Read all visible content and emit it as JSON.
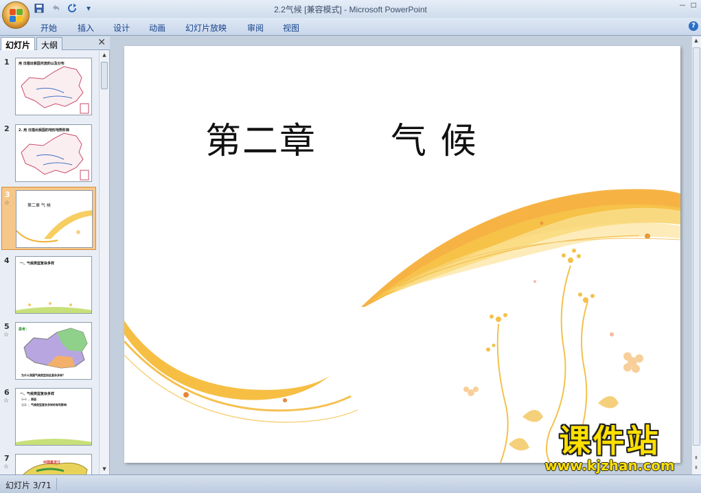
{
  "window": {
    "title": "2.2气候 [兼容模式] - Microsoft PowerPoint",
    "controls": [
      "—",
      "□"
    ]
  },
  "qat": {
    "save_icon": "save-icon",
    "undo_icon": "undo-icon",
    "redo_icon": "redo-icon",
    "customize": "▾"
  },
  "ribbon": {
    "tabs": [
      "开始",
      "插入",
      "设计",
      "动画",
      "幻灯片放映",
      "审阅",
      "视图"
    ],
    "help": "?"
  },
  "pane": {
    "tab_slides": "幻灯片",
    "tab_outline": "大纲",
    "close": "✕"
  },
  "thumbnails": [
    {
      "num": "1",
      "caption": "用 日描出我国河流的以及分布"
    },
    {
      "num": "2",
      "caption": "2. 用 日描出我国的地形地势阶梯"
    },
    {
      "num": "3",
      "caption": "第二章     气 候",
      "star": "☆"
    },
    {
      "num": "4",
      "caption": "一、气候类型复杂多样"
    },
    {
      "num": "5",
      "caption": "思考：",
      "caption2": "为什么我国气候类型如此复杂多样？",
      "star": "☆"
    },
    {
      "num": "6",
      "caption": "一、气候类型复杂多样",
      "caption2": "（一）、原因",
      "caption3": "（二）、气候类型复杂多样的有利影响",
      "star": "☆"
    },
    {
      "num": "7",
      "caption": "中国黑龙江",
      "star": "☆"
    }
  ],
  "slide": {
    "title": "第二章　　气 候"
  },
  "status": {
    "slide_info": "幻灯片 3/71"
  },
  "watermark": {
    "cn": "课件站",
    "url": "www.kjzhan.com"
  }
}
